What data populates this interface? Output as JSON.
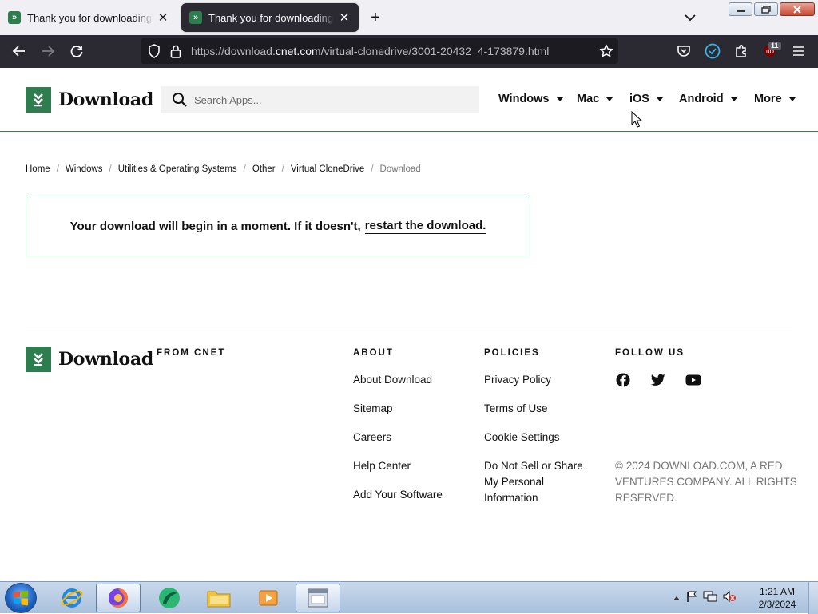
{
  "browser": {
    "tabs": [
      {
        "title": "Thank you for downloading Wi",
        "active": false
      },
      {
        "title": "Thank you for downloading Vir",
        "active": true
      }
    ],
    "url_prefix": "https://download.",
    "url_domain": "cnet.com",
    "url_path": "/virtual-clonedrive/3001-20432_4-173879.html",
    "extension_badge": "11"
  },
  "site": {
    "logo_text": "Download",
    "search_placeholder": "Search Apps...",
    "nav": [
      {
        "label": "Windows"
      },
      {
        "label": "Mac"
      },
      {
        "label": "iOS"
      },
      {
        "label": "Android"
      },
      {
        "label": "More"
      }
    ],
    "brand_color": "#2e7d4f"
  },
  "breadcrumb": [
    {
      "label": "Home"
    },
    {
      "label": "Windows"
    },
    {
      "label": "Utilities & Operating Systems"
    },
    {
      "label": "Other"
    },
    {
      "label": "Virtual CloneDrive"
    },
    {
      "label": "Download"
    }
  ],
  "download_box": {
    "message": "Your download will begin in a moment. If it doesn't,",
    "link": "restart the download."
  },
  "footer": {
    "logo_text": "Download",
    "from_heading": "FROM CNET",
    "about_heading": "ABOUT",
    "about_links": [
      "About Download",
      "Sitemap",
      "Careers",
      "Help Center",
      "Add Your Software"
    ],
    "policies_heading": "POLICIES",
    "policies_links": [
      "Privacy Policy",
      "Terms of Use",
      "Cookie Settings",
      "Do Not Sell or Share My Personal Information"
    ],
    "follow_heading": "FOLLOW US",
    "social": [
      "facebook-icon",
      "twitter-icon",
      "youtube-icon"
    ],
    "copyright": "© 2024 DOWNLOAD.COM, A RED VENTURES COMPANY. ALL RIGHTS RESERVED."
  },
  "taskbar": {
    "time": "1:21 AM",
    "date": "2/3/2024",
    "items": [
      "internet-explorer-icon",
      "firefox-icon",
      "app-icon",
      "file-explorer-icon",
      "media-player-icon",
      "window-icon"
    ]
  }
}
